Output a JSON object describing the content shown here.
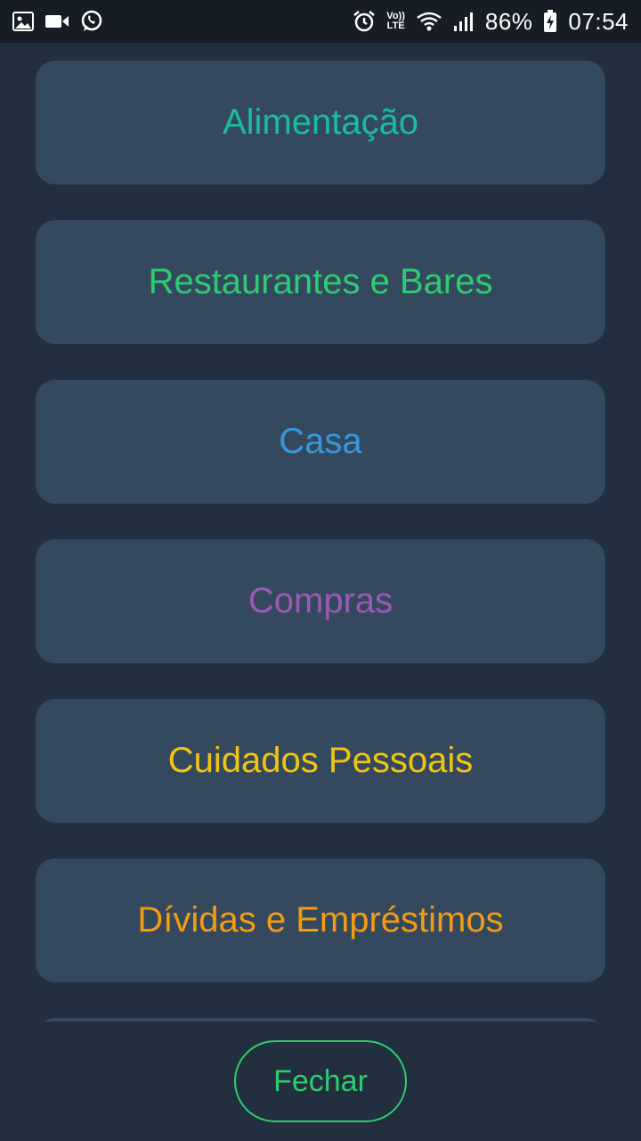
{
  "status_bar": {
    "battery": "86%",
    "time": "07:54",
    "volte_top": "Vo))",
    "volte_bottom": "LTE",
    "left_icons": [
      "image-icon",
      "video-camera-icon",
      "whatsapp-icon"
    ],
    "right_icons": [
      "alarm-icon",
      "volte-icon",
      "wifi-icon",
      "signal-icon",
      "battery-charging-icon"
    ]
  },
  "categories": [
    {
      "label": "Alimentação",
      "color": "#1abc9c"
    },
    {
      "label": "Restaurantes e Bares",
      "color": "#2ecc71"
    },
    {
      "label": "Casa",
      "color": "#3498db"
    },
    {
      "label": "Compras",
      "color": "#9b59b6"
    },
    {
      "label": "Cuidados Pessoais",
      "color": "#f1c40f"
    },
    {
      "label": "Dívidas e Empréstimos",
      "color": "#f39c12"
    },
    {
      "label": "",
      "color": "#e67e22"
    }
  ],
  "footer": {
    "close_label": "Fechar",
    "accent": "#2ecc71"
  },
  "colors": {
    "background": "#222f3e",
    "card": "#34495e",
    "status_bar": "#161d24"
  }
}
